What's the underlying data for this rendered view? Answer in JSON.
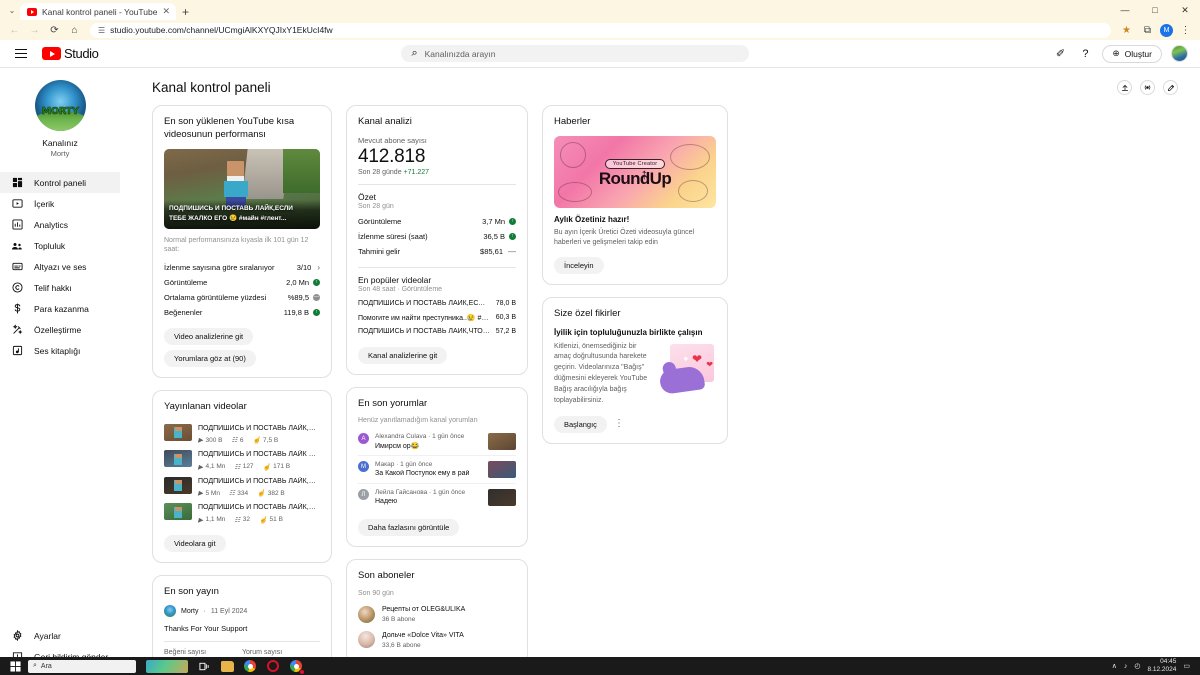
{
  "browser": {
    "tab_title": "Kanal kontrol paneli - YouTube",
    "new_tab_label": "+",
    "close_tab_label": "✕",
    "url": "studio.youtube.com/channel/UCmgiAlKXYQJIxY1EkUcI4fw",
    "back_icon": "←",
    "forward_icon": "→",
    "reload_icon": "⟳",
    "home_icon": "⌂",
    "site_icon": "☰",
    "star_icon": "★",
    "extensions_icon": "⧉",
    "profile_initial": "M",
    "menu_icon": "⋮",
    "minimize": "—",
    "maximize": "□",
    "close": "✕",
    "tab_list_icon": "⌄"
  },
  "header": {
    "logo_text": "Studio",
    "search_placeholder": "Kanalınızda arayın",
    "search_icon": "⌕",
    "feedback_icon": "✐",
    "help_icon": "?",
    "create_label": "Oluştur",
    "create_icon": "⊕"
  },
  "sidebar": {
    "channel_label": "Kanalınız",
    "channel_name": "Morty",
    "avatar_text": "MORTY",
    "items": [
      {
        "label": "Kontrol paneli",
        "icon": "dashboard",
        "active": true
      },
      {
        "label": "İçerik",
        "icon": "content",
        "active": false
      },
      {
        "label": "Analytics",
        "icon": "analytics",
        "active": false
      },
      {
        "label": "Topluluk",
        "icon": "community",
        "active": false
      },
      {
        "label": "Altyazı ve ses",
        "icon": "subtitles",
        "active": false
      },
      {
        "label": "Telif hakkı",
        "icon": "copyright",
        "active": false
      },
      {
        "label": "Para kazanma",
        "icon": "monetization",
        "active": false
      },
      {
        "label": "Özelleştirme",
        "icon": "customization",
        "active": false
      },
      {
        "label": "Ses kitaplığı",
        "icon": "audio-library",
        "active": false
      }
    ],
    "bottom_items": [
      {
        "label": "Ayarlar",
        "icon": "settings"
      },
      {
        "label": "Geri bildirim gönder",
        "icon": "feedback"
      }
    ]
  },
  "page": {
    "title": "Kanal kontrol paneli",
    "actions": [
      {
        "name": "upload",
        "icon": "↑"
      },
      {
        "name": "go-live",
        "icon": "((•))"
      },
      {
        "name": "create-post",
        "icon": "✎"
      }
    ]
  },
  "short_performance": {
    "title": "En son yüklenen YouTube kısa videosunun performansı",
    "thumbnail_overlay_line1": "ПОДПИШИСЬ И ПОСТАВЬ ЛАЙК,ЕСЛИ",
    "thumbnail_overlay_line2": "ТЕБЕ ЖАЛКО ЕГО 😢 #майн #глент...",
    "note": "Normal performansınıza kıyasla ilk 101 gün 12 saat:",
    "rows": [
      {
        "label": "İzlenme sayısına göre sıralanıyor",
        "value": "3/10",
        "badge": "chevron"
      },
      {
        "label": "Görüntüleme",
        "value": "2,0 Mn",
        "badge": "green"
      },
      {
        "label": "Ortalama görüntüleme yüzdesi",
        "value": "%89,5",
        "badge": "grey"
      },
      {
        "label": "Beğenenler",
        "value": "119,8 B",
        "badge": "green"
      }
    ],
    "buttons": [
      "Video analizlerine git",
      "Yorumlara göz at (90)"
    ]
  },
  "channel_analytics": {
    "title": "Kanal analizi",
    "subscriber_label": "Mevcut abone sayısı",
    "subscriber_count": "412.818",
    "delta_prefix": "Son 28 günde ",
    "delta_value": "+71.227",
    "summary_title": "Özet",
    "summary_period": "Son 28 gün",
    "summary_rows": [
      {
        "label": "Görüntüleme",
        "value": "3,7 Mn",
        "badge": "green"
      },
      {
        "label": "İzlenme süresi (saat)",
        "value": "36,5 B",
        "badge": "green"
      },
      {
        "label": "Tahmini gelir",
        "value": "$85,61",
        "badge": "dash"
      }
    ],
    "top_title": "En popüler videolar",
    "top_sub": "Son 48 saat · Görüntüleme",
    "top_videos": [
      {
        "title": "ПОДПИШИСЬ И ПОСТАВЬ ЛАЙК,ЕСЛИ ТЕБЕ Ж...",
        "views": "78,0 B"
      },
      {
        "title": "Помогите им найти преступника..😢 #майнкра...",
        "views": "60,3 B"
      },
      {
        "title": "ПОДПИШИСЬ И ПОСТАВЬ ЛАЙК,ЧТОБЫ СПАСТ...",
        "views": "57,2 B"
      }
    ],
    "button": "Kanal analizlerine git"
  },
  "news": {
    "title": "Haberler",
    "banner_chip": "YouTube Creator",
    "banner_word": "RoundUp",
    "headline": "Aylık Özetiniz hazır!",
    "body": "Bu ayın İçerik Üretici Özeti videosuyla güncel haberleri ve gelişmeleri takip edin",
    "button": "İnceleyin"
  },
  "ideas": {
    "title": "Size özel fikirler",
    "headline": "İyilik için topluluğunuzla birlikte çalışın",
    "body": "Kitlenizi, önemsediğiniz bir amaç doğrultusunda harekete geçirin. Videolarınıza \"Bağış\" düğmesini ekleyerek YouTube Bağış aracılığıyla bağış toplayabilirsiniz.",
    "button": "Başlangıç",
    "kebab": "⋮"
  },
  "published_videos": {
    "title": "Yayınlanan videolar",
    "items": [
      {
        "title": "ПОДПИШИСЬ И ПОСТАВЬ ЛАЙК,ЧТОБЫ ПО...",
        "views": "300 B",
        "comments": "6",
        "likes": "7,5 B"
      },
      {
        "title": "ПОДПИШИСЬ И ПОСТАВЬ ЛАЙК ЧТОБЫ ПО...",
        "views": "4,1 Mn",
        "comments": "127",
        "likes": "171 B"
      },
      {
        "title": "ПОДПИШИСЬ И ПОСТАВЬ ЛАЙК,ЧТОБЫ СП...",
        "views": "5 Mn",
        "comments": "334",
        "likes": "382 B"
      },
      {
        "title": "ПОДПИШИСЬ И ПОСТАВЬ ЛАЙК,ЧТОБЫ ПО...",
        "views": "1,1 Mn",
        "comments": "32",
        "likes": "51 B"
      }
    ],
    "button": "Videolara git",
    "views_icon": "▶",
    "comments_icon": "☷",
    "likes_icon": "☝"
  },
  "comments": {
    "title": "En son yorumlar",
    "subtitle": "Henüz yanıtlamadığım kanal yorumları",
    "items": [
      {
        "author": "Alexandra Culava",
        "time": "1 gün önce",
        "text": "Имирсм ор😂",
        "initial": "A",
        "color": "#9b59d0"
      },
      {
        "author": "Макар",
        "time": "1 gün önce",
        "text": "За Какой Поступок ему в рай",
        "initial": "M",
        "color": "#4a6fd0"
      },
      {
        "author": "Лейла Гайсанова",
        "time": "1 gün önce",
        "text": "Надею",
        "initial": "Л",
        "color": "#9aa0a6"
      }
    ],
    "separator": "·",
    "button": "Daha fazlasını görüntüle"
  },
  "latest_post": {
    "title": "En son yayın",
    "author": "Morty",
    "separator": "·",
    "date": "11 Eyl 2024",
    "text": "Thanks For Your Support",
    "stat_labels": [
      "Beğeni sayısı",
      "Yorum sayısı"
    ]
  },
  "subscribers": {
    "title": "Son aboneler",
    "period": "Son 90 gün",
    "items": [
      {
        "name": "Рецепты от OLEG&ULIKA",
        "subs": "36 B abone"
      },
      {
        "name": "Дольче «Dolce Vita» VITA",
        "subs": "33,6 B abone"
      }
    ]
  },
  "taskbar": {
    "search_placeholder": "Ara",
    "search_icon": "⌕",
    "start_icon": "⊞",
    "taskview_icon": "❑",
    "tray_chevron": "∧",
    "volume_icon": "♪",
    "network_icon": "◴",
    "time": "04:45",
    "date": "8.12.2024",
    "notification_icon": "▭"
  }
}
